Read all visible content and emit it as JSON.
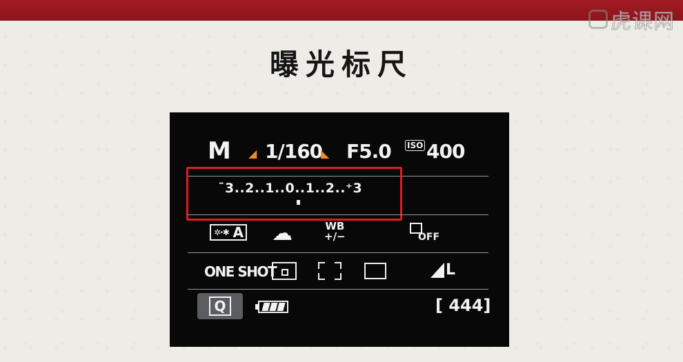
{
  "watermark": {
    "text": "虎课网"
  },
  "title": "曝光标尺",
  "camera_screen": {
    "shooting_mode": "M",
    "shutter_speed": "1/160",
    "aperture": "F5.0",
    "iso_badge": "ISO",
    "iso_value": "400",
    "exposure_scale": "¯3..2..1..0..1..2..⁺3",
    "exposure_level": 0,
    "picture_style_label": "A",
    "white_balance_shift": "WB\n+/−",
    "flash_off_label": "OFF",
    "af_mode": "ONE SHOT",
    "quick_menu": "Q",
    "shots_remaining": "[ 444]"
  },
  "icons": {
    "shutter_dial_marks": "orange-dial-icon",
    "white_balance": "cloudy-icon",
    "metering": "evaluative-metering-icon",
    "af_area": "af-area-icon",
    "drive": "single-shot-icon",
    "quality": "large-fine-icon",
    "battery": "battery-icon"
  },
  "colors": {
    "highlight": "#e11a24",
    "dial_accent": "#f08a23",
    "top_bar": "#a11c23"
  }
}
